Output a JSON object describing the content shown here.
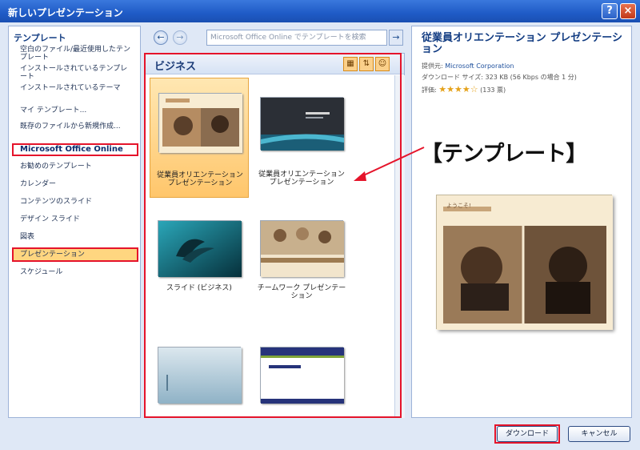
{
  "window": {
    "title": "新しいプレゼンテーション",
    "help": "?",
    "close": "×"
  },
  "left": {
    "header": "テンプレート",
    "items": [
      "空白のファイル/最近使用したテンプレート",
      "インストールされているテンプレート",
      "インストールされているテーマ",
      "マイ テンプレート...",
      "既存のファイルから新規作成...",
      "Microsoft Office Online",
      "お勧めのテンプレート",
      "カレンダー",
      "コンテンツのスライド",
      "デザイン スライド",
      "図表",
      "プレゼンテーション",
      "スケジュール"
    ]
  },
  "nav": {
    "back": "←",
    "forward": "→",
    "search_placeholder": "Microsoft Office Online でテンプレートを検索",
    "go": "→"
  },
  "gallery": {
    "title": "ビジネス",
    "tiles": [
      {
        "label": "従業員オリエンテーション プレゼンテーション"
      },
      {
        "label": "従業員オリエンテーション プレゼンテーション"
      },
      {
        "label": "スライド (ビジネス)"
      },
      {
        "label": "チームワーク プレゼンテーション"
      },
      {
        "label": ""
      },
      {
        "label": ""
      }
    ]
  },
  "detail": {
    "title": "従業員オリエンテーション プレゼンテーション",
    "provider_label": "提供元:",
    "provider": "Microsoft Corporation",
    "download_label": "ダウンロード サイズ:",
    "download_size": "323 KB (56 Kbps の場合 1 分)",
    "rating_label": "評価:",
    "rating_stars": "★★★★☆",
    "votes": "(133 票)",
    "preview_caption": "ようこそ!"
  },
  "footer": {
    "download": "ダウンロード",
    "cancel": "キャンセル"
  },
  "annotation": "【テンプレート】",
  "colors": {
    "highlight_red": "#e5142b",
    "selected_orange": "#ffc66b"
  }
}
